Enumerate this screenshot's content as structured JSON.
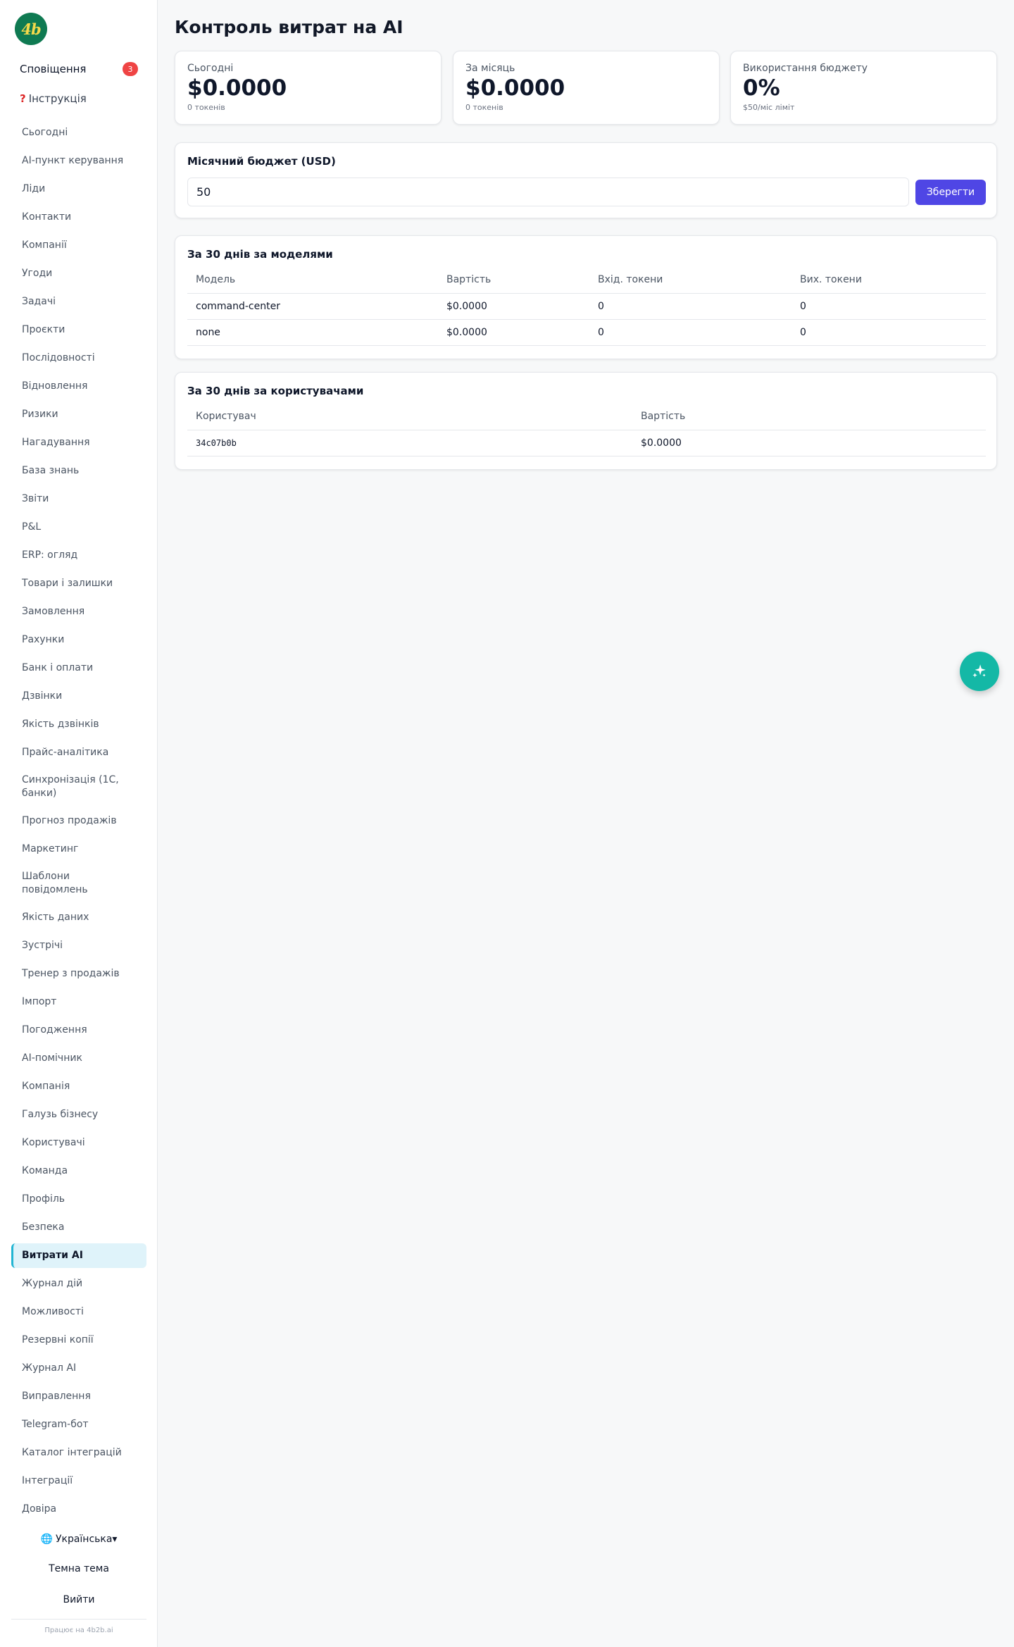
{
  "brand": {
    "logo_text": "4b",
    "logo_color": "#0f7a52",
    "logo_text_color": "#f5d94a"
  },
  "sidebar": {
    "notifications_label": "Сповіщення",
    "notifications_count": "3",
    "guide_icon": "?",
    "guide_label": "Інструкція",
    "items": [
      "Сьогодні",
      "AI-пункт керування",
      "Ліди",
      "Контакти",
      "Компанії",
      "Угоди",
      "Задачі",
      "Проєкти",
      "Послідовності",
      "Відновлення",
      "Ризики",
      "Нагадування",
      "База знань",
      "Звіти",
      "P&L",
      "ERP: огляд",
      "Товари і залишки",
      "Замовлення",
      "Рахунки",
      "Банк і оплати",
      "Дзвінки",
      "Якість дзвінків",
      "Прайс-аналітика",
      "Синхронізація (1С, банки)",
      "Прогноз продажів",
      "Маркетинг",
      "Шаблони повідомлень",
      "Якість даних",
      "Зустрічі",
      "Тренер з продажів",
      "Імпорт",
      "Погодження",
      "AI-помічник",
      "Компанія",
      "Галузь бізнесу",
      "Користувачі",
      "Команда",
      "Профіль",
      "Безпека",
      "Витрати AI",
      "Журнал дій",
      "Можливості",
      "Резервні копії",
      "Журнал AI",
      "Виправлення",
      "Telegram-бот",
      "Каталог інтеграцій",
      "Інтеграції",
      "Довіра"
    ],
    "active_item": "Витрати AI",
    "language_icon": "🌐",
    "language_label": "Українська▾",
    "theme_label": "Темна тема",
    "logout_label": "Вийти",
    "powered_by": "Працює на 4b2b.ai"
  },
  "page": {
    "title": "Контроль витрат на AI"
  },
  "stats": [
    {
      "label": "Сьогодні",
      "value": "$0.0000",
      "sub": "0 токенів"
    },
    {
      "label": "За місяць",
      "value": "$0.0000",
      "sub": "0 токенів"
    },
    {
      "label": "Використання бюджету",
      "value": "0%",
      "sub": "$50/міс ліміт"
    }
  ],
  "budget": {
    "title": "Місячний бюджет (USD)",
    "value": "50",
    "save_label": "Зберегти",
    "button_color": "#4f46e5"
  },
  "models_table": {
    "title": "За 30 днів за моделями",
    "columns": [
      "Модель",
      "Вартість",
      "Вхід. токени",
      "Вих. токени"
    ],
    "rows": [
      [
        "command-center",
        "$0.0000",
        "0",
        "0"
      ],
      [
        "none",
        "$0.0000",
        "0",
        "0"
      ]
    ]
  },
  "users_table": {
    "title": "За 30 днів за користувачами",
    "columns": [
      "Користувач",
      "Вартість"
    ],
    "rows": [
      [
        "34c07b0b",
        "$0.0000"
      ]
    ]
  },
  "fab": {
    "icon": "sparkles-icon",
    "color": "#14b8a6"
  }
}
